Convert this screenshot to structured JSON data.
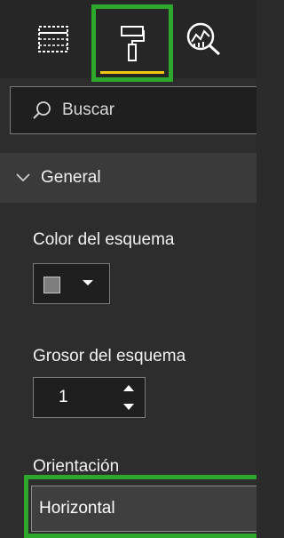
{
  "tabs": {
    "items": [
      {
        "name": "fields",
        "icon": "fields-table-icon"
      },
      {
        "name": "format",
        "icon": "paint-roller-icon",
        "active": true
      },
      {
        "name": "analytics",
        "icon": "analytics-magnifier-icon"
      }
    ],
    "active_underline_color": "#f2c811",
    "highlight_color": "#2ea82c"
  },
  "search": {
    "placeholder": "Buscar",
    "icon": "search-icon"
  },
  "section": {
    "title": "General",
    "icon": "chevron-down-icon",
    "expanded": true
  },
  "fields": {
    "outline_color": {
      "label": "Color del esquema",
      "swatch_color": "#7d7d7d",
      "icon": "caret-down-icon"
    },
    "outline_weight": {
      "label": "Grosor del esquema",
      "value": "1",
      "icons": [
        "caret-up-icon",
        "caret-down-icon"
      ]
    },
    "orientation": {
      "label": "Orientación",
      "value": "Horizontal"
    }
  }
}
